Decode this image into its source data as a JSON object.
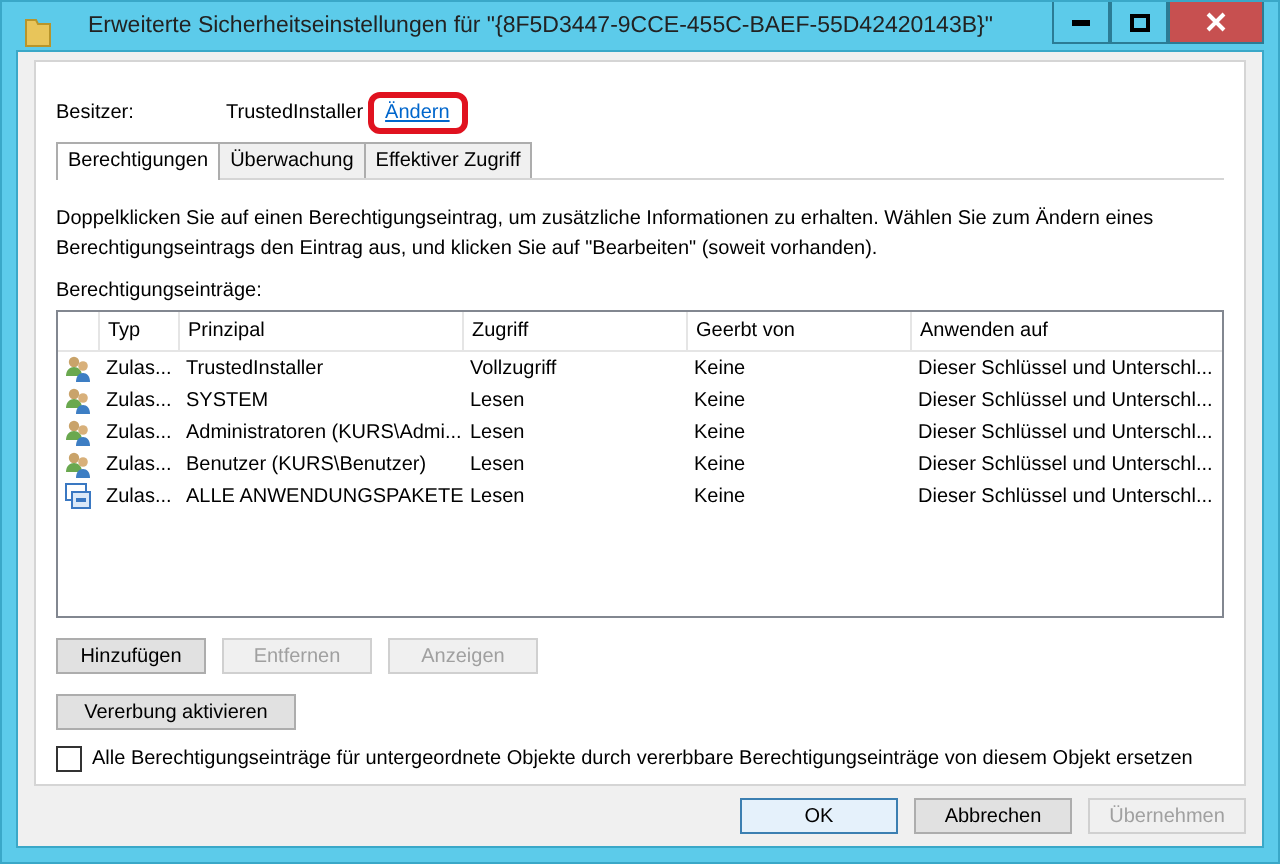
{
  "window": {
    "title": "Erweiterte Sicherheitseinstellungen für \"{8F5D3447-9CCE-455C-BAEF-55D42420143B}\""
  },
  "owner": {
    "label": "Besitzer:",
    "value": "TrustedInstaller",
    "link": "Ändern",
    "highlighted": true
  },
  "tabs": [
    {
      "label": "Berechtigungen",
      "selected": true
    },
    {
      "label": "Überwachung",
      "selected": false
    },
    {
      "label": "Effektiver Zugriff",
      "selected": false
    }
  ],
  "description": "Doppelklicken Sie auf einen Berechtigungseintrag, um zusätzliche Informationen zu erhalten. Wählen Sie zum Ändern eines Berechtigungseintrags den Eintrag aus, und klicken Sie auf \"Bearbeiten\" (soweit vorhanden).",
  "entries_label": "Berechtigungseinträge:",
  "table": {
    "columns": [
      "Typ",
      "Prinzipal",
      "Zugriff",
      "Geerbt von",
      "Anwenden auf"
    ],
    "rows": [
      {
        "kind": "user",
        "cells": [
          "Zulas...",
          "TrustedInstaller",
          "Vollzugriff",
          "Keine",
          "Dieser Schlüssel und Unterschl..."
        ]
      },
      {
        "kind": "user",
        "cells": [
          "Zulas...",
          "SYSTEM",
          "Lesen",
          "Keine",
          "Dieser Schlüssel und Unterschl..."
        ]
      },
      {
        "kind": "user",
        "cells": [
          "Zulas...",
          "Administratoren (KURS\\Admi...",
          "Lesen",
          "Keine",
          "Dieser Schlüssel und Unterschl..."
        ]
      },
      {
        "kind": "user",
        "cells": [
          "Zulas...",
          "Benutzer (KURS\\Benutzer)",
          "Lesen",
          "Keine",
          "Dieser Schlüssel und Unterschl..."
        ]
      },
      {
        "kind": "package",
        "cells": [
          "Zulas...",
          "ALLE ANWENDUNGSPAKETE",
          "Lesen",
          "Keine",
          "Dieser Schlüssel und Unterschl..."
        ]
      }
    ]
  },
  "entry_buttons": [
    {
      "label": "Hinzufügen",
      "disabled": false
    },
    {
      "label": "Entfernen",
      "disabled": true
    },
    {
      "label": "Anzeigen",
      "disabled": true
    }
  ],
  "inheritance_button": "Vererbung aktivieren",
  "replace_checkbox": {
    "label": "Alle Berechtigungseinträge für untergeordnete Objekte durch vererbbare Berechtigungseinträge von diesem Objekt ersetzen",
    "checked": false
  },
  "dialog_buttons": [
    {
      "label": "OK",
      "disabled": false,
      "default": true
    },
    {
      "label": "Abbrechen",
      "disabled": false,
      "default": false
    },
    {
      "label": "Übernehmen",
      "disabled": true,
      "default": false
    }
  ]
}
